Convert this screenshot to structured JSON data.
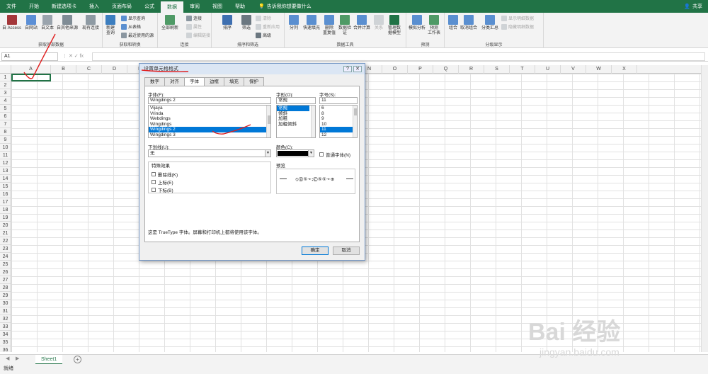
{
  "menubar": {
    "tabs": [
      "文件",
      "开始",
      "新建选项卡",
      "插入",
      "页面布局",
      "公式",
      "数据",
      "审阅",
      "视图",
      "帮助"
    ],
    "active_tab": "数据",
    "tell_me": "告诉我你想要做什么",
    "share": "共享"
  },
  "ribbon": {
    "get_external": {
      "buttons": [
        "自 Access",
        "自网站",
        "自文本",
        "自其他来源",
        "现有连接"
      ],
      "label": "获取外部数据"
    },
    "get_transform": {
      "new_query": "新建\n查询",
      "items": [
        "显示查询",
        "从表格",
        "最近使用的源"
      ],
      "label": "获取和转换"
    },
    "connections": {
      "refresh_all": "全部刷新",
      "items": [
        "连接",
        "属性",
        "编辑链接"
      ],
      "label": "连接"
    },
    "sort_filter": {
      "sort": "排序",
      "filter": "筛选",
      "items": [
        "清除",
        "重新应用",
        "高级"
      ],
      "label": "排序和筛选"
    },
    "data_tools": {
      "buttons": [
        "分列",
        "快速填充",
        "删除\n重复值",
        "数据验\n证",
        "合并计算",
        "关系",
        "管理数\n据模型"
      ],
      "label": "数据工具"
    },
    "forecast": {
      "buttons": [
        "模拟分析",
        "预测\n工作表"
      ],
      "label": "预测"
    },
    "outline": {
      "buttons": [
        "组合",
        "取消组合",
        "分类汇总"
      ],
      "items": [
        "显示明细数据",
        "隐藏明细数据"
      ],
      "label": "分级显示"
    }
  },
  "formula_bar": {
    "name_box": "A1",
    "fx_symbols": "⋮  ✕  ✓  fx",
    "value": ""
  },
  "grid": {
    "columns": [
      "A",
      "B",
      "C",
      "D",
      "E",
      "F",
      "G",
      "H",
      "I",
      "J",
      "K",
      "L",
      "M",
      "N",
      "O",
      "P",
      "Q",
      "R",
      "S",
      "T",
      "U",
      "V",
      "W",
      "X"
    ],
    "rows": [
      "1",
      "2",
      "3",
      "4",
      "5",
      "6",
      "7",
      "8",
      "9",
      "10",
      "11",
      "12",
      "13",
      "14",
      "15",
      "16",
      "17",
      "18",
      "19",
      "20",
      "21",
      "22",
      "23",
      "24",
      "25",
      "26",
      "27",
      "28",
      "29",
      "30",
      "31",
      "32",
      "33",
      "34",
      "35",
      "36"
    ]
  },
  "sheets": {
    "active": "Sheet1",
    "add": "+"
  },
  "status": {
    "text": "就绪"
  },
  "dialog": {
    "title": "设置单元格格式",
    "help": "?",
    "close": "✕",
    "tabs": [
      "数字",
      "对齐",
      "字体",
      "边框",
      "填充",
      "保护"
    ],
    "active_tab": "字体",
    "font_label": "字体(F):",
    "font_value": "Wingdings 2",
    "font_list": [
      "Vijaya",
      "Vrinda",
      "Webdings",
      "Wingdings",
      "Wingdings 2",
      "Wingdings 3"
    ],
    "font_selected": "Wingdings 2",
    "style_label": "字形(O):",
    "style_value": "常规",
    "style_list": [
      "常规",
      "倾斜",
      "加粗",
      "加粗倾斜"
    ],
    "style_selected": "常规",
    "size_label": "字号(S):",
    "size_value": "11",
    "size_list": [
      "6",
      "8",
      "9",
      "10",
      "11",
      "12"
    ],
    "size_selected": "11",
    "underline_label": "下划线(U):",
    "underline_value": "无",
    "color_label": "颜色(C):",
    "normal_font_label": "普通字体(N)",
    "effects_label": "特殊效果",
    "effects": [
      "删除线(K)",
      "上标(E)",
      "下标(B)"
    ],
    "preview_label": "预览",
    "preview_text": "⦸⓪⑤➛⨟Ⓒ⑤⑤➛⊕",
    "description": "这是 TrueType 字体。屏幕和打印机上都将使用该字体。",
    "ok": "确定",
    "cancel": "取消"
  },
  "watermark": {
    "brand": "Bai 经验",
    "url": "jingyan.baidu.com"
  },
  "colors": {
    "excel_green": "#217346",
    "selection_blue": "#0078d7",
    "annotation_red": "#e02020"
  }
}
